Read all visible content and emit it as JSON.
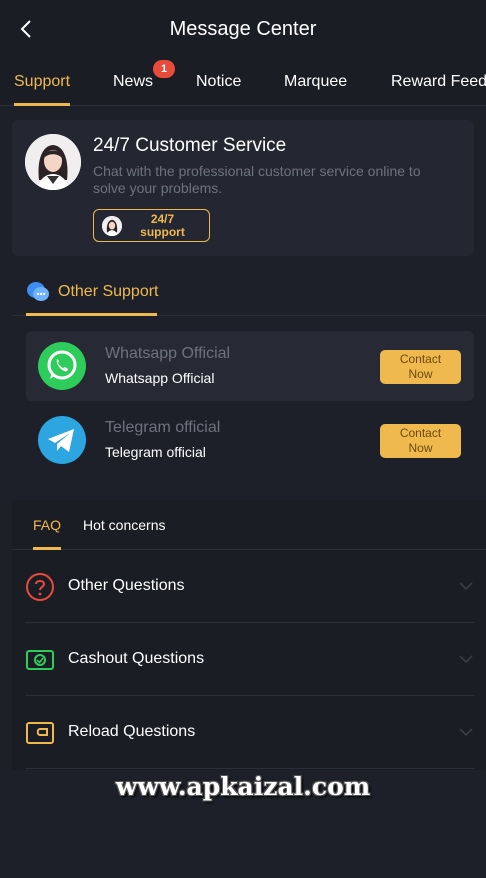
{
  "header": {
    "title": "Message Center"
  },
  "tabs": [
    {
      "label": "Support",
      "active": true
    },
    {
      "label": "News",
      "badge": "1"
    },
    {
      "label": "Notice"
    },
    {
      "label": "Marquee"
    },
    {
      "label": "Reward Feed"
    }
  ],
  "service": {
    "title": "24/7 Customer Service",
    "description": "Chat with the professional customer service online to solve your problems.",
    "button_label": "24/7\nsupport"
  },
  "other_support": {
    "tab_label": "Other Support",
    "contacts": [
      {
        "subtitle": "Whatsapp Official",
        "name": "Whatsapp Official",
        "button": "Contact Now",
        "icon": "whatsapp-icon",
        "color": "#2ecc5b"
      },
      {
        "subtitle": "Telegram official",
        "name": "Telegram official",
        "button": "Contact Now",
        "icon": "telegram-icon",
        "color": "#2ca5e0"
      }
    ]
  },
  "faq": {
    "tabs": [
      {
        "label": "FAQ",
        "active": true
      },
      {
        "label": "Hot concerns"
      }
    ],
    "items": [
      {
        "label": "Other Questions",
        "icon": "question-circle-icon",
        "color": "#e84b3c"
      },
      {
        "label": "Cashout Questions",
        "icon": "cashout-icon",
        "color": "#2ecc5b"
      },
      {
        "label": "Reload Questions",
        "icon": "wallet-icon",
        "color": "#f0b94e"
      }
    ]
  },
  "watermark": "www.apkaizal.com",
  "colors": {
    "accent": "#f0b94e",
    "background": "#1e2029",
    "badge": "#e84b3c"
  }
}
